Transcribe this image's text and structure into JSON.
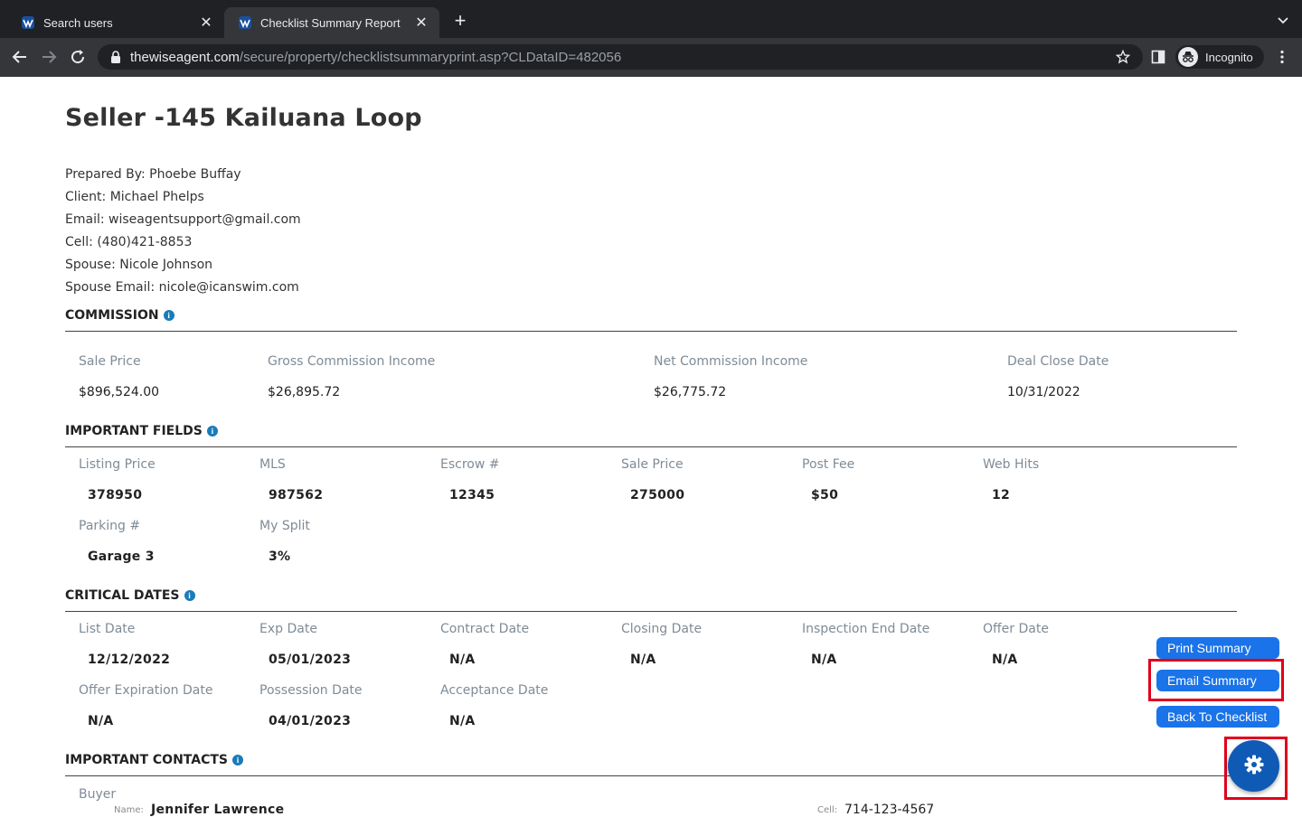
{
  "browser": {
    "tabs": [
      {
        "title": "Search users",
        "active": false
      },
      {
        "title": "Checklist Summary Report",
        "active": true
      }
    ],
    "url_host": "thewiseagent.com",
    "url_path": "/secure/property/checklistsummaryprint.asp?CLDataID=482056",
    "profile_label": "Incognito"
  },
  "report": {
    "title": "Seller -145 Kailuana Loop",
    "info_lines": [
      "Prepared By: Phoebe Buffay",
      "Client: Michael Phelps",
      "Email: wiseagentsupport@gmail.com",
      "Cell: (480)421-8853",
      "Spouse: Nicole Johnson",
      "Spouse Email: nicole@icanswim.com"
    ],
    "commission": {
      "heading": "COMMISSION",
      "fields": [
        {
          "label": "Sale Price",
          "value": "$896,524.00"
        },
        {
          "label": "Gross Commission Income",
          "value": "$26,895.72"
        },
        {
          "label": "Net Commission Income",
          "value": "$26,775.72"
        },
        {
          "label": "Deal Close Date",
          "value": "10/31/2022"
        }
      ]
    },
    "important_fields": {
      "heading": "IMPORTANT FIELDS",
      "fields": [
        {
          "label": "Listing Price",
          "value": "378950"
        },
        {
          "label": "MLS",
          "value": "987562"
        },
        {
          "label": "Escrow #",
          "value": "12345"
        },
        {
          "label": "Sale Price",
          "value": "275000"
        },
        {
          "label": "Post Fee",
          "value": "$50"
        },
        {
          "label": "Web Hits",
          "value": "12"
        },
        {
          "label": "Parking #",
          "value": "Garage 3"
        },
        {
          "label": "My Split",
          "value": "3%"
        }
      ]
    },
    "critical_dates": {
      "heading": "CRITICAL DATES",
      "fields": [
        {
          "label": "List Date",
          "value": "12/12/2022"
        },
        {
          "label": "Exp Date",
          "value": "05/01/2023"
        },
        {
          "label": "Contract Date",
          "value": "N/A"
        },
        {
          "label": "Closing Date",
          "value": "N/A"
        },
        {
          "label": "Inspection End Date",
          "value": "N/A"
        },
        {
          "label": "Offer Date",
          "value": "N/A"
        },
        {
          "label": "Offer Expiration Date",
          "value": "N/A"
        },
        {
          "label": "Possession Date",
          "value": "04/01/2023"
        },
        {
          "label": "Acceptance Date",
          "value": "N/A"
        }
      ]
    },
    "important_contacts": {
      "heading": "IMPORTANT CONTACTS",
      "buyer_label": "Buyer",
      "name_label": "Name:",
      "name_value": "Jennifer Lawrence",
      "cell_label": "Cell:",
      "cell_value": "714-123-4567"
    }
  },
  "actions": {
    "print": "Print Summary",
    "email": "Email Summary",
    "back": "Back To Checklist",
    "settings_icon": "gear-icon"
  },
  "colors": {
    "accent_button": "#1a73e8",
    "highlight_box": "#e0001b",
    "gear_button": "#0f5ab5"
  }
}
